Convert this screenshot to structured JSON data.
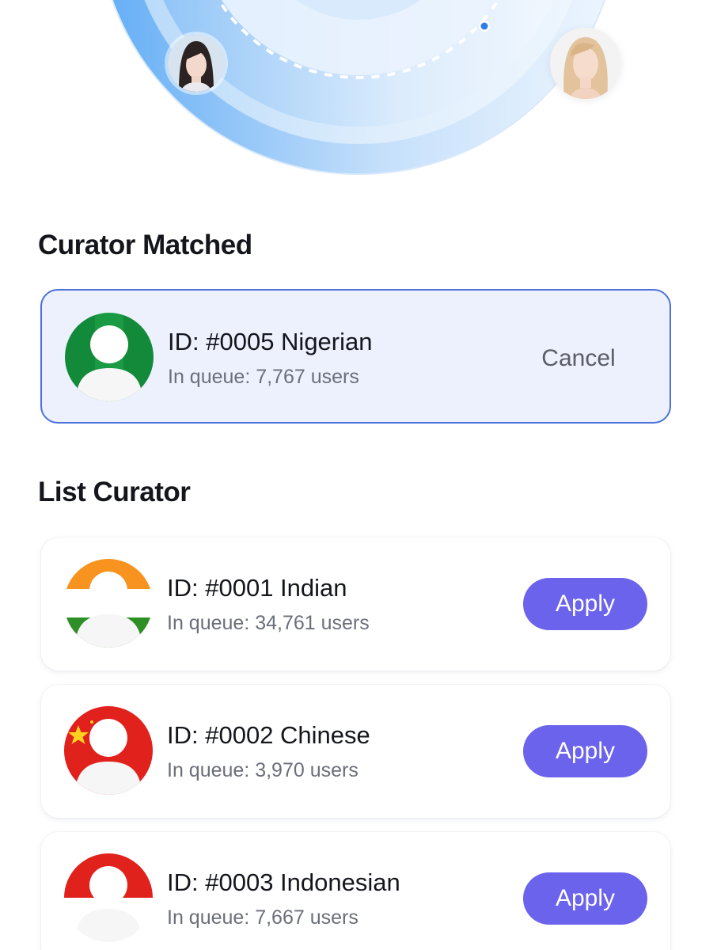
{
  "matched_section": {
    "title": "Curator Matched",
    "curator": {
      "id_label": "ID: #0005 Nigerian",
      "queue_label": "In queue: 7,767 users",
      "flag": "nigeria-flag",
      "action_label": "Cancel"
    }
  },
  "list_section": {
    "title": "List Curator",
    "curators": [
      {
        "id_label": "ID: #0001 Indian",
        "queue_label": "In queue: 34,761 users",
        "flag": "india-flag",
        "action_label": "Apply"
      },
      {
        "id_label": "ID: #0002 Chinese",
        "queue_label": "In queue: 3,970 users",
        "flag": "china-flag",
        "action_label": "Apply"
      },
      {
        "id_label": "ID: #0003 Indonesian",
        "queue_label": "In queue: 7,667 users",
        "flag": "indonesia-flag",
        "action_label": "Apply"
      }
    ]
  },
  "colors": {
    "accent": "#6b63ec",
    "matched_border": "#4c72d8",
    "matched_bg": "#ecf1fd",
    "radar_blue": "#5aa4f4"
  }
}
